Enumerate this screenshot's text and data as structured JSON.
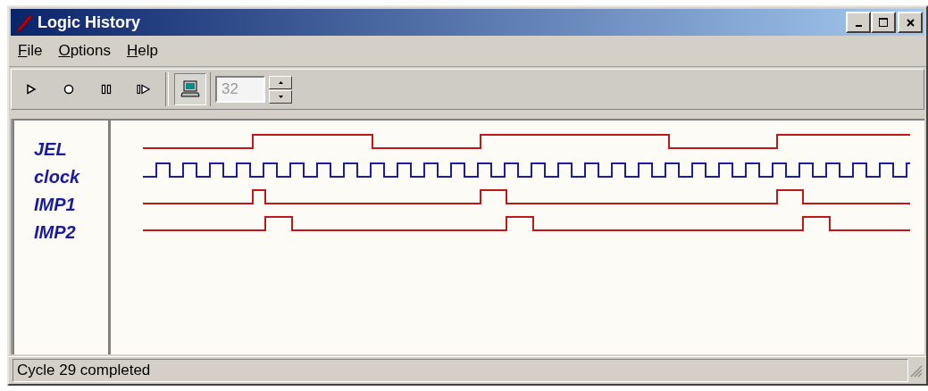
{
  "window": {
    "title": "Logic History"
  },
  "menu": [
    {
      "label": "File"
    },
    {
      "label": "Options"
    },
    {
      "label": "Help"
    }
  ],
  "toolbar": {
    "buttons": [
      {
        "kind": "run"
      },
      {
        "kind": "record"
      },
      {
        "kind": "pause"
      },
      {
        "kind": "step"
      },
      {
        "kind": "monitor",
        "selected": true
      }
    ],
    "cycles": {
      "value": "32",
      "disabled": true
    }
  },
  "signals": [
    {
      "name": "JEL",
      "color": "#c01818"
    },
    {
      "name": "clock",
      "color": "#1c1c9c"
    },
    {
      "name": "IMP1",
      "color": "#c01818"
    },
    {
      "name": "IMP2",
      "color": "#c01818"
    }
  ],
  "status_bar": "Cycle 29 completed"
}
